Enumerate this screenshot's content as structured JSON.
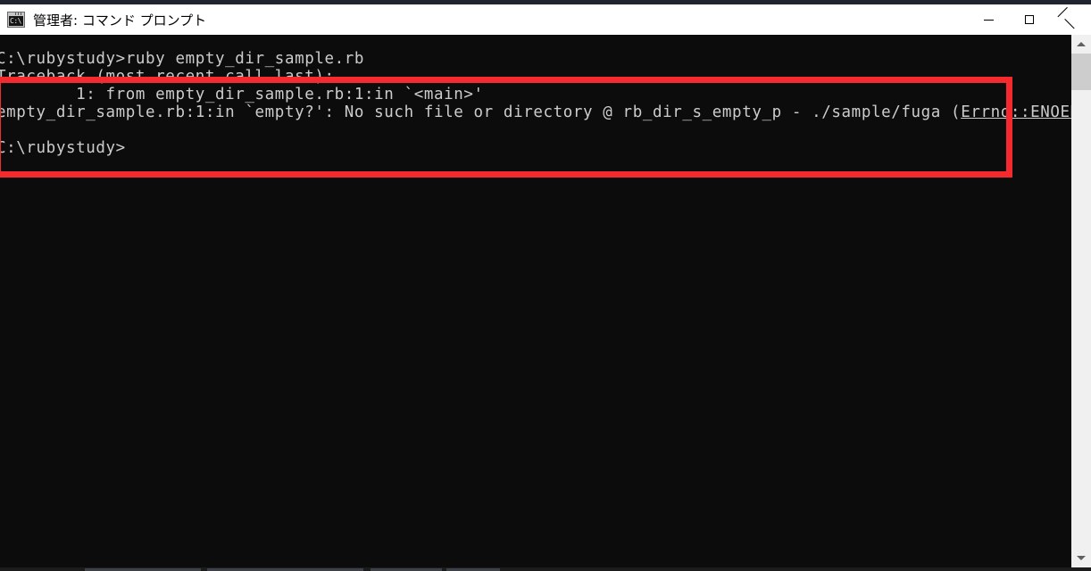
{
  "window": {
    "title": "管理者: コマンド プロンプト",
    "icon": "cmd-icon",
    "icon_prompt_text": "C:\\",
    "controls": {
      "minimize": "minimize-button",
      "maximize": "maximize-button",
      "close": "close-button"
    }
  },
  "console": {
    "background_color": "#0c0c0c",
    "text_color": "#cccccc",
    "lines": [
      "C:\\rubystudy>ruby empty_dir_sample.rb",
      "Traceback (most recent call last):",
      "        1: from empty_dir_sample.rb:1:in `<main>'",
      "empty_dir_sample.rb:1:in `empty?': No such file or directory @ rb_dir_s_empty_p - ./sample/fuga (",
      "C:\\rubystudy>"
    ],
    "error_class": "Errno::ENOENT",
    "error_close_paren": ")",
    "prompt": "C:\\rubystudy>",
    "command": "ruby empty_dir_sample.rb"
  },
  "annotation": {
    "shape": "rectangle",
    "color": "#f42a2f",
    "border_width_px": 7
  },
  "scrollbar": {
    "up_arrow": "scroll-up-arrow",
    "down_arrow": "scroll-down-arrow",
    "thumb": "scroll-thumb"
  }
}
